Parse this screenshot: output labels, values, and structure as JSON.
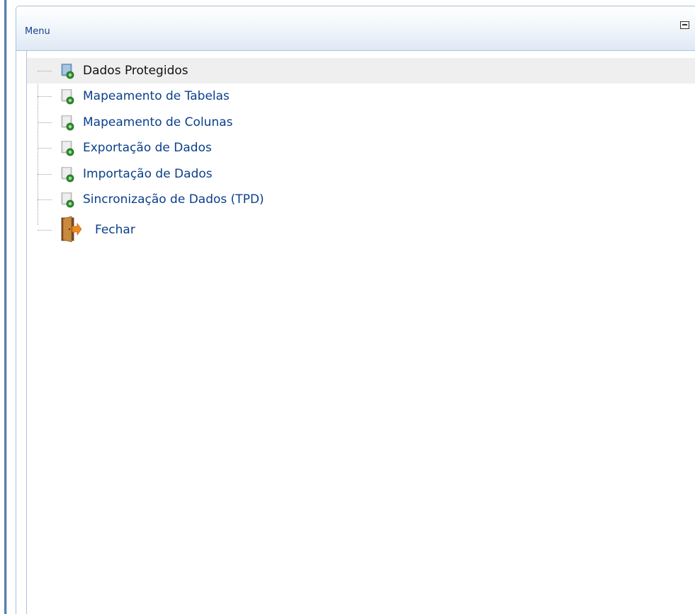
{
  "panel": {
    "title": "Menu"
  },
  "tree": {
    "items": [
      {
        "label": "Dados Protegidos",
        "icon": "document-icon",
        "selected": true
      },
      {
        "label": "Mapeamento de Tabelas",
        "icon": "document-icon",
        "selected": false
      },
      {
        "label": "Mapeamento de Colunas",
        "icon": "document-icon",
        "selected": false
      },
      {
        "label": "Exportação de Dados",
        "icon": "document-icon",
        "selected": false
      },
      {
        "label": "Importação de Dados",
        "icon": "document-icon",
        "selected": false
      },
      {
        "label": "Sincronização de Dados (TPD)",
        "icon": "document-icon",
        "selected": false
      }
    ],
    "close": {
      "label": "Fechar",
      "icon": "exit-door-icon"
    }
  },
  "colors": {
    "header_text": "#15428b",
    "link_text": "#0b3f8a",
    "selected_bg": "#efefef",
    "border": "#a9bfd6"
  }
}
